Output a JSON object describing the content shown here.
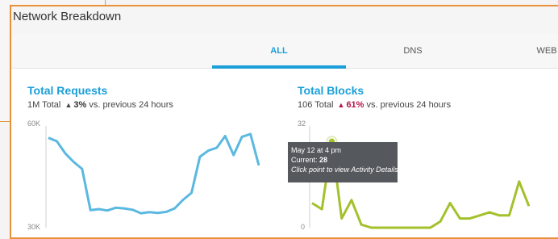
{
  "card": {
    "title": "Network Breakdown"
  },
  "tabs": [
    {
      "label": "ALL",
      "active": true
    },
    {
      "label": "DNS",
      "active": false
    },
    {
      "label": "WEB",
      "active": false
    }
  ],
  "requests": {
    "title": "Total Requests",
    "total": "1M Total",
    "arrow": "▲",
    "change": "3%",
    "suffix": "vs. previous 24 hours"
  },
  "blocks": {
    "title": "Total Blocks",
    "total": "106 Total",
    "arrow": "▲",
    "change": "61%",
    "suffix": "vs. previous 24 hours"
  },
  "tooltip": {
    "date": "May 12 at 4 pm",
    "current_label": "Current:",
    "current_value": "28",
    "hint": "Click point to view Activity Details"
  },
  "colors": {
    "accent": "#1a9fd9",
    "requests_line": "#5bb8e0",
    "blocks_line": "#a3c12b",
    "negative": "#b5134a",
    "frame": "#e8913a"
  },
  "chart_data": [
    {
      "type": "line",
      "title": "Total Requests",
      "y_ticks": [
        "60K",
        "30K"
      ],
      "ylim": [
        30000,
        60000
      ],
      "series": [
        {
          "values": [
            57500,
            56500,
            53000,
            50500,
            48500,
            36500,
            36800,
            36400,
            37200,
            37000,
            36600,
            35600,
            35900,
            35700,
            36000,
            37000,
            39500,
            41500,
            52000,
            53800,
            54600,
            58000,
            52500,
            57800,
            58600,
            49500
          ]
        }
      ]
    },
    {
      "type": "line",
      "title": "Total Blocks",
      "y_ticks": [
        "32",
        "0"
      ],
      "ylim": [
        0,
        32
      ],
      "series": [
        {
          "values": [
            8,
            6,
            28,
            3,
            9,
            1,
            0,
            0,
            0,
            0,
            0,
            0,
            0,
            2,
            8,
            3,
            3,
            4,
            5,
            4,
            4,
            15,
            7
          ]
        }
      ],
      "highlight": {
        "index": 2,
        "value": 28
      }
    }
  ]
}
